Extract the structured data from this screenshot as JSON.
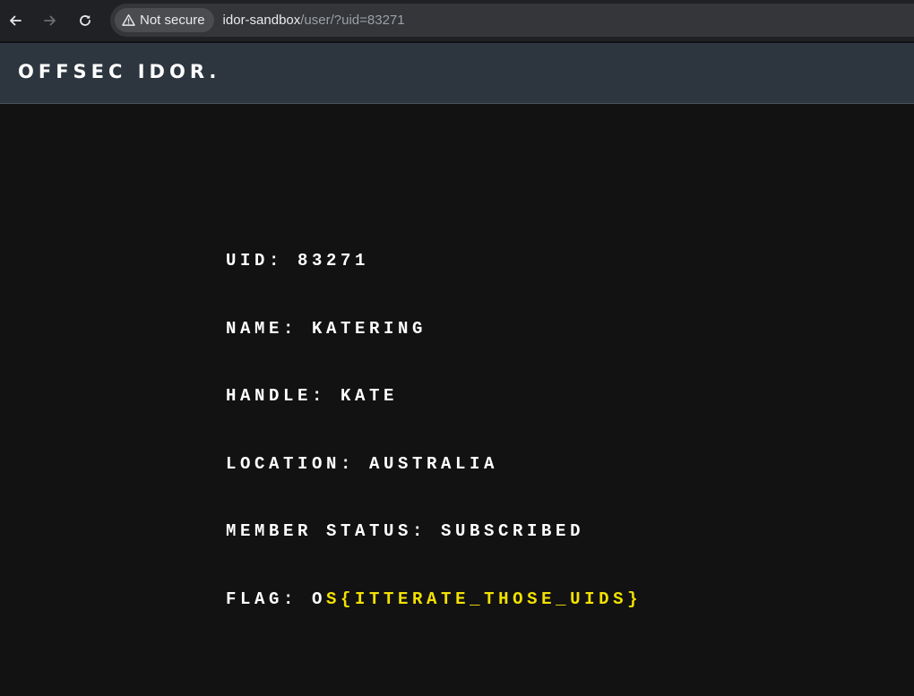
{
  "browser": {
    "security_label": "Not secure",
    "url_host": "idor-sandbox",
    "url_path": "/user/?uid=83271"
  },
  "site": {
    "brand": "OFFSEC IDOR."
  },
  "profile": {
    "uid_label": "UID:",
    "uid_value": "83271",
    "name_label": "NAME:",
    "name_value": "KATERING",
    "handle_label": "HANDLE:",
    "handle_value": "KATE",
    "location_label": "LOCATION:",
    "location_value": "AUSTRALIA",
    "status_label": "MEMBER STATUS:",
    "status_value": "SUBSCRIBED",
    "flag_label": "FLAG:",
    "flag_first": "O",
    "flag_rest": "S{ITTERATE_THOSE_UIDS}"
  },
  "colors": {
    "background": "#121212",
    "header": "#2d363f",
    "flag": "#f4e100"
  },
  "icons": [
    "back-arrow-icon",
    "forward-arrow-icon",
    "reload-icon",
    "warning-triangle-icon"
  ]
}
